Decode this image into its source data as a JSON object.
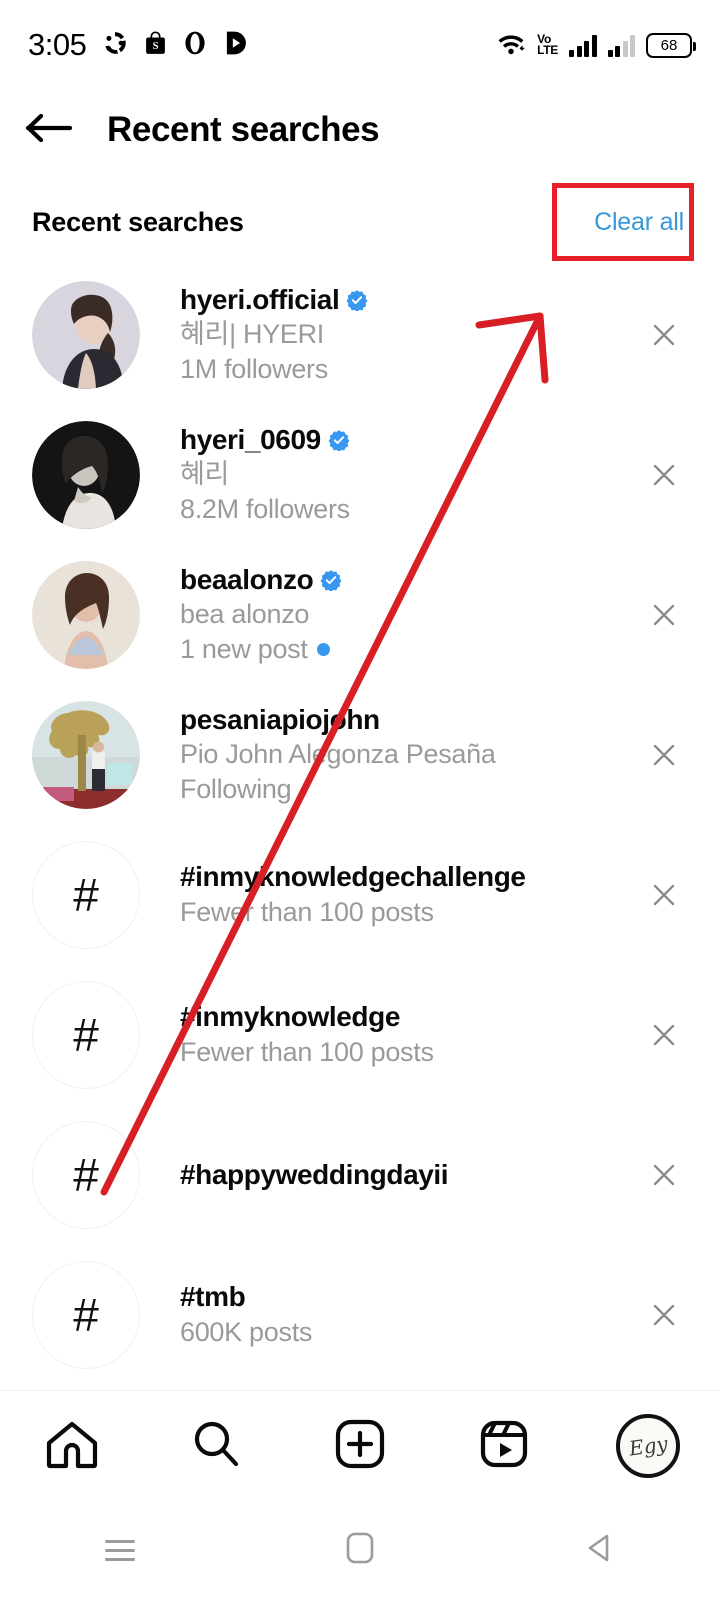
{
  "status_bar": {
    "time": "3:05",
    "left_icons": [
      "shareit-icon",
      "shopee-icon",
      "opera-icon",
      "video-player-icon"
    ],
    "network_label": "Vo",
    "network_label2": "LTE",
    "battery_level": "68",
    "right_icons": [
      "wifi-icon",
      "volte-icon",
      "signal-bars-icon",
      "signal-bars-2-icon",
      "battery-icon"
    ]
  },
  "header": {
    "back_icon": "back-arrow-icon",
    "title": "Recent searches"
  },
  "section": {
    "title": "Recent searches",
    "clear_all_label": "Clear all",
    "clear_all_color": "#3897d8"
  },
  "annotation": {
    "box_color": "#e8202a",
    "arrow_color": "#d81f26"
  },
  "results": [
    {
      "type": "account",
      "avatar": "photo-hyeri-official",
      "username": "hyeri.official",
      "verified": true,
      "fullname": "혜리| HYERI",
      "meta": "1M followers",
      "new_post": false,
      "remove_icon": "close-icon"
    },
    {
      "type": "account",
      "avatar": "photo-hyeri-0609",
      "username": "hyeri_0609",
      "verified": true,
      "fullname": "혜리",
      "meta": "8.2M followers",
      "new_post": false,
      "remove_icon": "close-icon"
    },
    {
      "type": "account",
      "avatar": "photo-beaalonzo",
      "username": "beaalonzo",
      "verified": true,
      "fullname": "bea alonzo",
      "meta": "1 new post",
      "new_post": true,
      "remove_icon": "close-icon"
    },
    {
      "type": "account",
      "avatar": "photo-pesaniapiojohn",
      "username": "pesaniapiojohn",
      "verified": false,
      "fullname": "Pio John Alegonza Pesaña",
      "meta": "Following",
      "new_post": false,
      "remove_icon": "close-icon"
    },
    {
      "type": "hashtag",
      "avatar": "hashtag-icon",
      "username": "#inmyknowledgechallenge",
      "verified": false,
      "fullname": "",
      "meta": "Fewer than 100 posts",
      "new_post": false,
      "remove_icon": "close-icon"
    },
    {
      "type": "hashtag",
      "avatar": "hashtag-icon",
      "username": "#inmyknowledge",
      "verified": false,
      "fullname": "",
      "meta": "Fewer than 100 posts",
      "new_post": false,
      "remove_icon": "close-icon"
    },
    {
      "type": "hashtag",
      "avatar": "hashtag-icon",
      "username": "#happyweddingdayii",
      "verified": false,
      "fullname": "",
      "meta": "",
      "new_post": false,
      "remove_icon": "close-icon"
    },
    {
      "type": "hashtag",
      "avatar": "hashtag-icon",
      "username": "#tmb",
      "verified": false,
      "fullname": "",
      "meta": "600K posts",
      "new_post": false,
      "remove_icon": "close-icon"
    }
  ],
  "bottom_nav": [
    {
      "icon": "home-icon",
      "label": "Home"
    },
    {
      "icon": "search-icon",
      "label": "Search"
    },
    {
      "icon": "create-post-icon",
      "label": "Create"
    },
    {
      "icon": "reels-icon",
      "label": "Reels"
    },
    {
      "icon": "profile-avatar",
      "label": "Profile"
    }
  ],
  "system_nav": [
    {
      "icon": "recents-icon"
    },
    {
      "icon": "home-square-icon"
    },
    {
      "icon": "back-triangle-icon"
    }
  ],
  "hash_glyph": "#"
}
